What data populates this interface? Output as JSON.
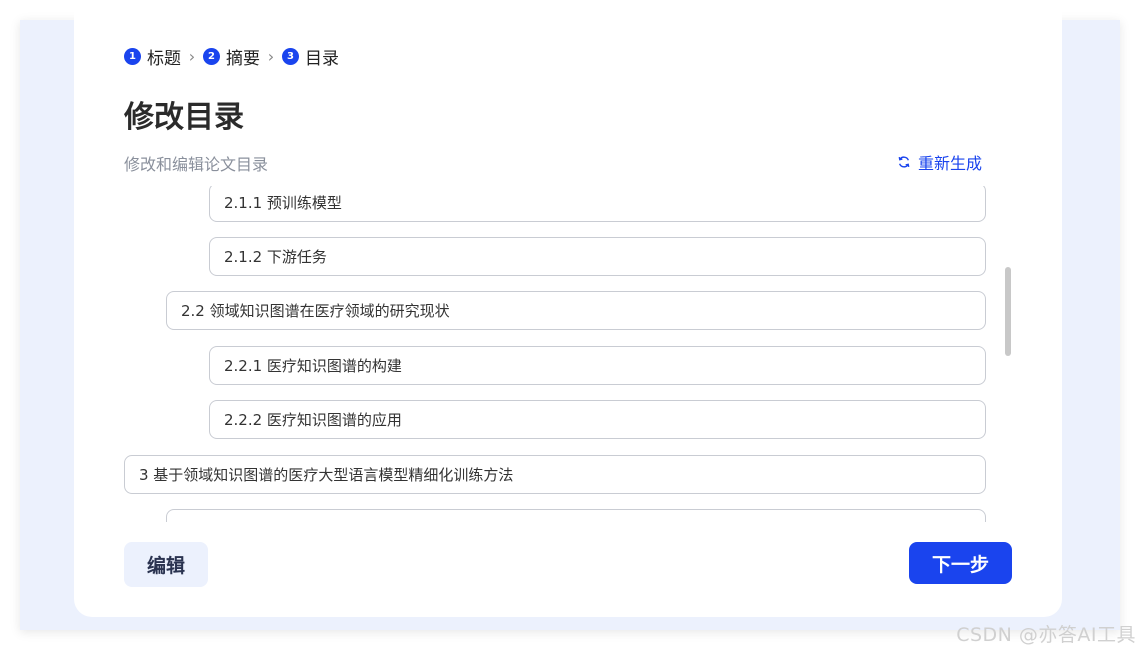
{
  "steps": [
    {
      "num": "1",
      "label": "标题"
    },
    {
      "num": "2",
      "label": "摘要"
    },
    {
      "num": "3",
      "label": "目录"
    }
  ],
  "step_separator_icon": "chevron-right-icon",
  "header": {
    "title": "修改目录",
    "subtitle": "修改和编辑论文目录",
    "regenerate_label": "重新生成",
    "regenerate_icon": "refresh-icon"
  },
  "toc": {
    "items": [
      {
        "level": 3,
        "text": "2.1.1 预训练模型"
      },
      {
        "level": 3,
        "text": "2.1.2 下游任务"
      },
      {
        "level": 2,
        "text": "2.2 领域知识图谱在医疗领域的研究现状"
      },
      {
        "level": 3,
        "text": "2.2.1 医疗知识图谱的构建"
      },
      {
        "level": 3,
        "text": "2.2.2 医疗知识图谱的应用"
      },
      {
        "level": 1,
        "text": "3 基于领域知识图谱的医疗大型语言模型精细化训练方法"
      },
      {
        "level": 2,
        "text": ""
      }
    ]
  },
  "footer": {
    "edit_label": "编辑",
    "next_label": "下一步"
  },
  "watermark": "CSDN @亦答AI工具",
  "colors": {
    "accent": "#1a44ee",
    "background_panel": "#ecf1fd",
    "border": "#c9ccd3"
  }
}
